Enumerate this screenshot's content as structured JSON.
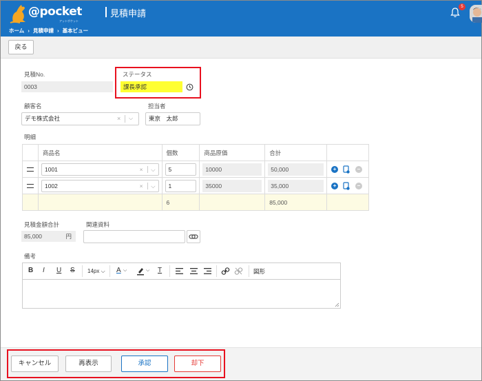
{
  "header": {
    "logo_text": "@pocket",
    "logo_sub": "アットポケット",
    "title": "見積申請",
    "notification_count": "5",
    "breadcrumb": [
      "ホーム",
      "見積申請",
      "基本ビュー"
    ],
    "breadcrumb_sep": "›",
    "brand_color": "#1a73c4"
  },
  "toolbar": {
    "back_label": "戻る"
  },
  "form": {
    "estimate_no_label": "見積No.",
    "estimate_no_value": "0003",
    "status_label": "ステータス",
    "status_value": "課長承認",
    "customer_label": "顧客名",
    "customer_value": "デモ株式会社",
    "staff_label": "担当者",
    "staff_value": "東京　太郎",
    "details_label": "明細",
    "total_label": "見積金額合計",
    "total_value": "85,000",
    "total_unit": "円",
    "docs_label": "関連資料",
    "docs_value": "",
    "notes_label": "備考"
  },
  "table": {
    "headers": [
      "商品名",
      "個数",
      "商品原価",
      "合計"
    ],
    "rows": [
      {
        "product": "1001",
        "qty": "5",
        "cost": "10000",
        "total": "50,000"
      },
      {
        "product": "1002",
        "qty": "1",
        "cost": "35000",
        "total": "35,000"
      }
    ],
    "summary": {
      "qty": "6",
      "total": "85,000"
    }
  },
  "editor": {
    "bold": "B",
    "italic": "I",
    "underline": "U",
    "strike": "S",
    "font_size": "14px",
    "text_color": "A",
    "clear_format": "T",
    "shape_label": "図形"
  },
  "footer": {
    "cancel_label": "キャンセル",
    "reload_label": "再表示",
    "approve_label": "承認",
    "reject_label": "却下"
  },
  "colors": {
    "highlight": "#ffff33",
    "annotation_red": "#e8101e",
    "approve_blue": "#1a73c4",
    "reject_red": "#e53935",
    "add_icon": "#1a73c4"
  }
}
